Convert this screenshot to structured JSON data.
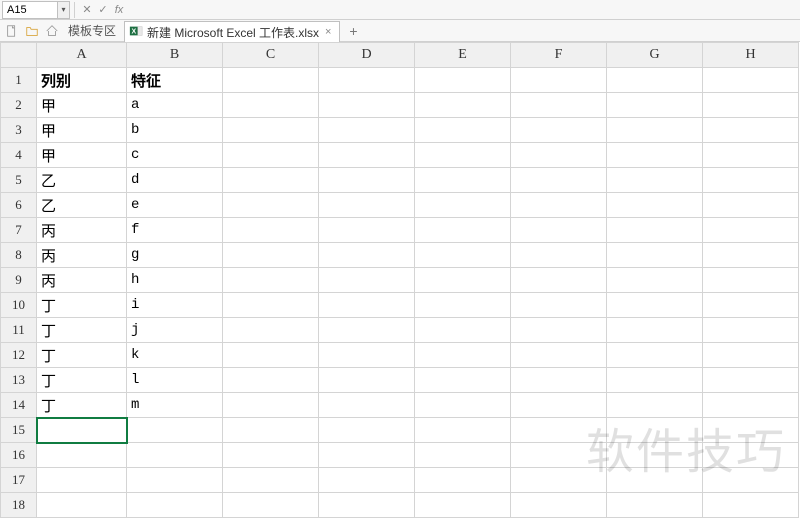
{
  "namebox": {
    "value": "A15"
  },
  "formula_bar": {
    "cancel_icon": "✕",
    "confirm_icon": "✓",
    "fx_label": "fx",
    "value": ""
  },
  "tabstrip": {
    "template_zone_label": "模板专区",
    "doc_tab_label": "新建 Microsoft Excel 工作表.xlsx",
    "close_glyph": "×",
    "plus_glyph": "+"
  },
  "columns": [
    "A",
    "B",
    "C",
    "D",
    "E",
    "F",
    "G",
    "H"
  ],
  "rows": [
    "1",
    "2",
    "3",
    "4",
    "5",
    "6",
    "7",
    "8",
    "9",
    "10",
    "11",
    "12",
    "13",
    "14",
    "15",
    "16",
    "17",
    "18"
  ],
  "headers": {
    "A": "列别",
    "B": "特征"
  },
  "data_rows": [
    {
      "A": "甲",
      "B": "a"
    },
    {
      "A": "甲",
      "B": "b"
    },
    {
      "A": "甲",
      "B": "c"
    },
    {
      "A": "乙",
      "B": "d"
    },
    {
      "A": "乙",
      "B": "e"
    },
    {
      "A": "丙",
      "B": "f"
    },
    {
      "A": "丙",
      "B": "g"
    },
    {
      "A": "丙",
      "B": "h"
    },
    {
      "A": "丁",
      "B": "i"
    },
    {
      "A": "丁",
      "B": "j"
    },
    {
      "A": "丁",
      "B": "k"
    },
    {
      "A": "丁",
      "B": "l"
    },
    {
      "A": "丁",
      "B": "m"
    }
  ],
  "selected_cell": "A15",
  "watermark": "软件技巧"
}
